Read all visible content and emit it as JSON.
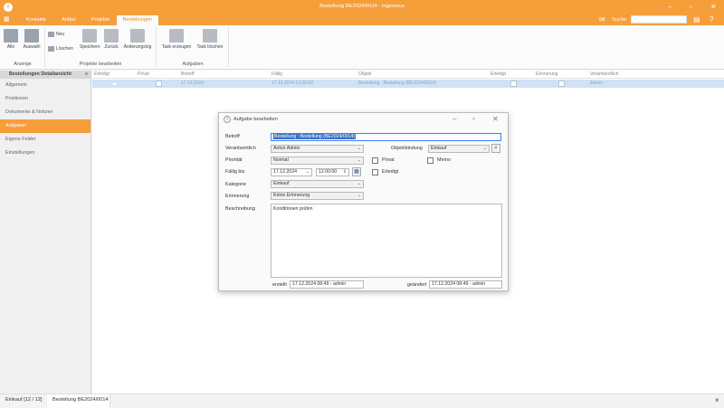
{
  "window": {
    "title": "Bestellung BE2024/0014 - ingenious"
  },
  "menu": {
    "tabs": [
      "Kontakte",
      "Artikel",
      "Projekte",
      "Bestellungen"
    ],
    "search_label": "Suche:"
  },
  "ribbon": {
    "buttons": {
      "alle": "Alle",
      "auswahl": "Auswahl",
      "neu": "Neu",
      "loeschen": "Löschen",
      "speichern": "Speichern",
      "zurueck": "Zurück",
      "aenderungslog": "Änderungslog",
      "task_erzeugen": "Task erzeugen",
      "task_loeschen": "Task löschen"
    },
    "groups": {
      "anzeige": "Anzeige",
      "projekte_bearbeiten": "Projekte bearbeiten",
      "aufgaben": "Aufgaben"
    }
  },
  "sidebar": {
    "header": "Bestellungen Detailansicht",
    "collapse": "«",
    "items": [
      "Allgemein",
      "Positionen",
      "Dokumente & Notizen",
      "Aufgaben",
      "Eigene Felder",
      "Einstellungen"
    ],
    "active_index": 3
  },
  "grid": {
    "columns": [
      "Erledigt",
      "Privat",
      "Betreff",
      "Fällig",
      "Objekt",
      "Erledigt",
      "Erinnerung",
      "Verantwortlich"
    ],
    "row": {
      "arrow": "➨",
      "date": "17.12.2024",
      "faellig": "17.12.2024 12:00:00",
      "objekt": "Bestellung : Bestellung (BE2024/0014)",
      "verantwortlich": "Admin"
    }
  },
  "dialog": {
    "title": "Aufgabe bearbeiten",
    "labels": {
      "betreff": "Betreff",
      "verantwortlich": "Verantwortlich",
      "prioritaet": "Priorität",
      "faellig_bis": "Fällig bis",
      "kategorie": "Kategorie",
      "erinnerung": "Erinnerung",
      "beschreibung": "Beschreibung",
      "objektbindung": "Objektbindung",
      "privat": "Privat",
      "memo": "Memo",
      "erledigt": "Erledigt",
      "erstellt": "erstellt",
      "geaendert": "geändert"
    },
    "values": {
      "betreff": "Bestellung : Bestellung (BE2024/0014)",
      "verantwortlich": "Anton Admin",
      "prioritaet": "Normal",
      "faellig_datum": "17.12.2024",
      "faellig_zeit": "12:00:00",
      "kategorie": "Einkauf",
      "erinnerung": "Keine Erinnerung",
      "objektbindung": "Einkauf",
      "beschreibung": "Konditionen prüfen",
      "erstellt": "17.12.2024 08:49 - admin",
      "geaendert": "17.12.2024 08:49 - admin"
    },
    "privat": false,
    "memo": false,
    "erledigt": false
  },
  "statusbar": {
    "left": "Einkauf [12 / 12]",
    "tab": "Bestellung BE2024/0014"
  },
  "colors": {
    "accent": "#f59e3a",
    "selection": "#cfe2f6",
    "highlight": "#3a70c9"
  }
}
